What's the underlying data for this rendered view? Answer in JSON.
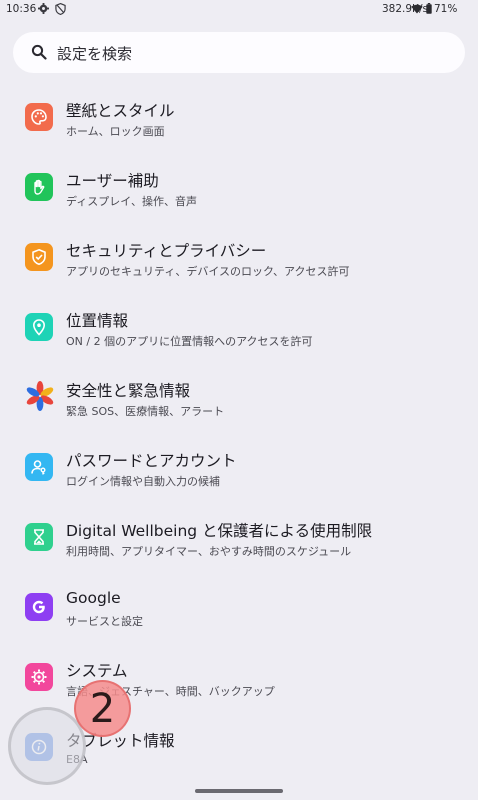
{
  "status_bar": {
    "time": "10:36",
    "net_speed": "382.9K/s",
    "battery_pct": "71%"
  },
  "search": {
    "placeholder": "設定を検索"
  },
  "settings": [
    {
      "title": "壁紙とスタイル",
      "subtitle": "ホーム、ロック画面",
      "color": "#f26b4c",
      "icon": "palette-icon"
    },
    {
      "title": "ユーザー補助",
      "subtitle": "ディスプレイ、操作、音声",
      "color": "#21c45a",
      "icon": "hand-icon"
    },
    {
      "title": "セキュリティとプライバシー",
      "subtitle": "アプリのセキュリティ、デバイスのロック、アクセス許可",
      "color": "#f4951e",
      "icon": "shield-check-icon"
    },
    {
      "title": "位置情報",
      "subtitle": "ON / 2 個のアプリに位置情報へのアクセスを許可",
      "color": "#1ed3b6",
      "icon": "location-pin-icon"
    },
    {
      "title": "安全性と緊急情報",
      "subtitle": "緊急 SOS、医療情報、アラート",
      "color": "#ffffff",
      "icon": "emergency-star-icon"
    },
    {
      "title": "パスワードとアカウント",
      "subtitle": "ログイン情報や自動入力の候補",
      "color": "#33b7f2",
      "icon": "account-key-icon"
    },
    {
      "title": "Digital Wellbeing と保護者による使用制限",
      "subtitle": "利用時間、アプリタイマー、おやすみ時間のスケジュール",
      "color": "#2fd08e",
      "icon": "hourglass-icon"
    },
    {
      "title": "Google",
      "subtitle": "サービスと設定",
      "color": "#8e3ff2",
      "icon": "google-g-icon"
    },
    {
      "title": "システム",
      "subtitle": "言語、ジェスチャー、時間、バックアップ",
      "color": "#f2479c",
      "icon": "system-gear-icon"
    },
    {
      "title": "タブレット情報",
      "subtitle": "E8A",
      "color": "#7da3e8",
      "icon": "info-icon"
    }
  ],
  "overlay": {
    "step_number": "2"
  }
}
